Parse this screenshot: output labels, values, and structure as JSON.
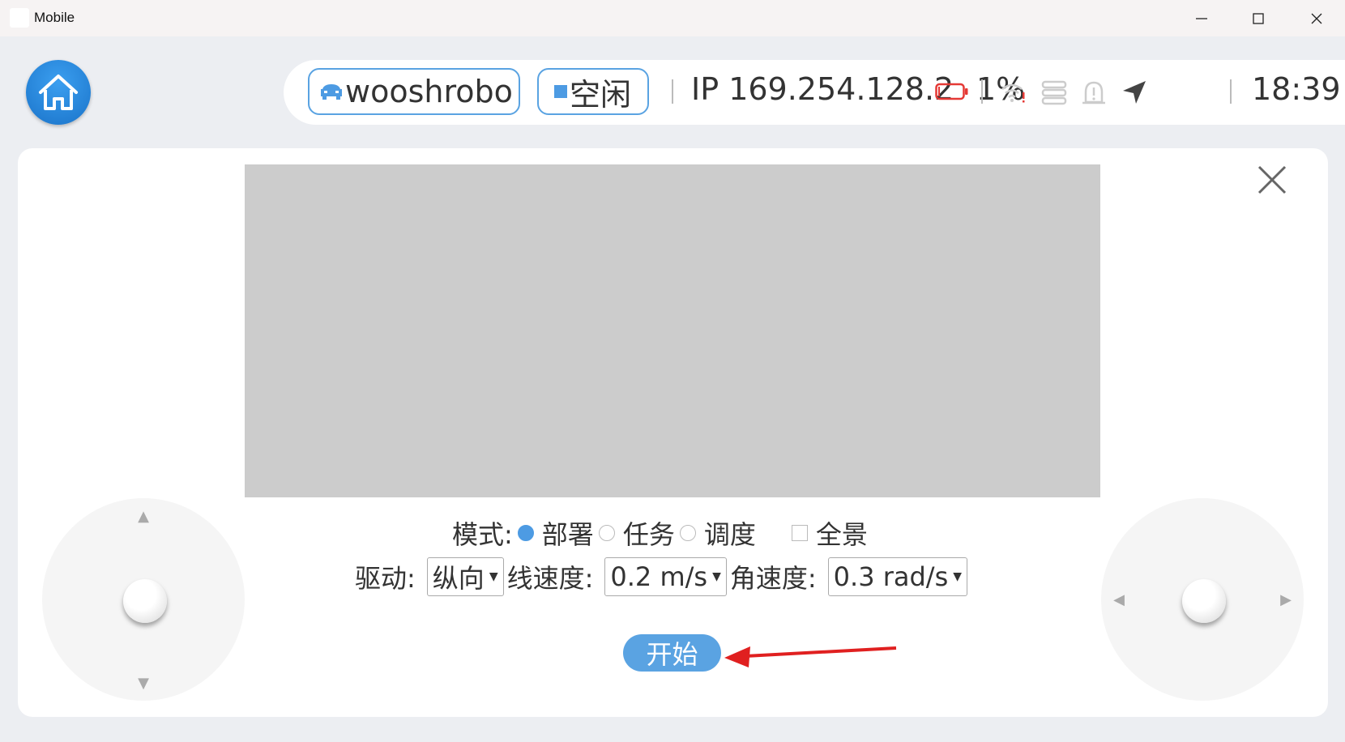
{
  "window": {
    "title": "Mobile"
  },
  "status": {
    "robot_name": "wooshrobo",
    "state": "空闲",
    "ip": "IP 169.254.128.2",
    "battery": "1%",
    "battery_level": 0.01,
    "time": "18:39"
  },
  "controls": {
    "mode_label": "模式:",
    "mode_options": [
      "部署",
      "任务",
      "调度"
    ],
    "mode_selected": "部署",
    "panorama_label": "全景",
    "drive_label": "驱动:",
    "drive_value": "纵向",
    "linear_speed_label": "线速度:",
    "linear_speed_value": "0.2 m/s",
    "angular_speed_label": "角速度:",
    "angular_speed_value": "0.3 rad/s",
    "start_label": "开始"
  },
  "colors": {
    "accent": "#5aa3e2",
    "home_blue": "#1a73c9",
    "battery_red": "#e53935",
    "annotation_red": "#e02020",
    "video_placeholder": "#cccccc"
  },
  "icons": [
    "home-icon",
    "robot-car-icon",
    "state-square-icon",
    "battery-icon",
    "wifi-warning-icon",
    "server-icon",
    "alert-icon",
    "navigation-icon",
    "close-icon"
  ]
}
